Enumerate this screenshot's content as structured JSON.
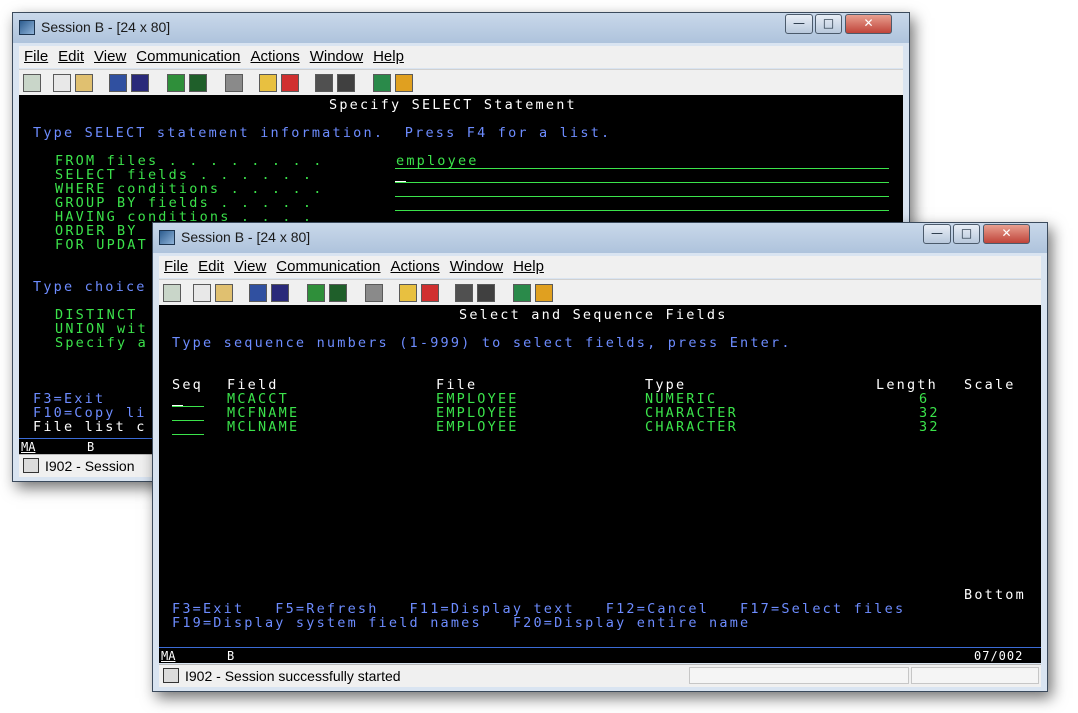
{
  "back_window": {
    "title": "Session B - [24 x 80]",
    "controls": {
      "minimize": "—",
      "maximize": "□",
      "close": "✕"
    },
    "menu": [
      "File",
      "Edit",
      "View",
      "Communication",
      "Actions",
      "Window",
      "Help"
    ],
    "screen": {
      "heading": "Specify SELECT Statement",
      "instruction": "Type SELECT statement information.  Press F4 for a list.",
      "fields": [
        {
          "label": "FROM files . . . . . . . .",
          "value": "employee"
        },
        {
          "label": "SELECT fields . . . . . . ",
          "value": ""
        },
        {
          "label": "WHERE conditions . . . . .",
          "value": ""
        },
        {
          "label": "GROUP BY fields . . . . . ",
          "value": ""
        },
        {
          "label": "HAVING conditions . . . . ",
          "value": ""
        },
        {
          "label": "ORDER BY",
          "value": ""
        },
        {
          "label": "FOR UPDAT",
          "value": ""
        }
      ],
      "choice_heading": "Type choice",
      "choices": [
        "DISTINCT",
        "UNION wit",
        "Specify a"
      ],
      "fkey_1": "F3=Exit",
      "fkey_2": "F10=Copy li",
      "file_list": "File list c",
      "oia_mode": "MA",
      "oia_session": "B"
    },
    "status": "I902 - Session"
  },
  "front_window": {
    "title": "Session B - [24 x 80]",
    "controls": {
      "minimize": "—",
      "maximize": "□",
      "close": "✕"
    },
    "menu": [
      "File",
      "Edit",
      "View",
      "Communication",
      "Actions",
      "Window",
      "Help"
    ],
    "screen": {
      "heading": "Select and Sequence Fields",
      "instruction": "Type sequence numbers (1-999) to select fields, press Enter.",
      "columns": {
        "seq": "Seq",
        "field": "Field",
        "file": "File",
        "type": "Type",
        "length": "Length",
        "scale": "Scale"
      },
      "rows": [
        {
          "field": "MCACCT",
          "file": "EMPLOYEE",
          "type": "NUMERIC",
          "length": "6"
        },
        {
          "field": "MCFNAME",
          "file": "EMPLOYEE",
          "type": "CHARACTER",
          "length": "32"
        },
        {
          "field": "MCLNAME",
          "file": "EMPLOYEE",
          "type": "CHARACTER",
          "length": "32"
        }
      ],
      "bottom": "Bottom",
      "fkeys_1": "F3=Exit   F5=Refresh   F11=Display text   F12=Cancel   F17=Select files",
      "fkeys_2": "F19=Display system field names   F20=Display entire name",
      "oia_mode": "MA",
      "oia_session": "B",
      "oia_cursor": "07/002"
    },
    "status": "I902 - Session successfully started"
  }
}
